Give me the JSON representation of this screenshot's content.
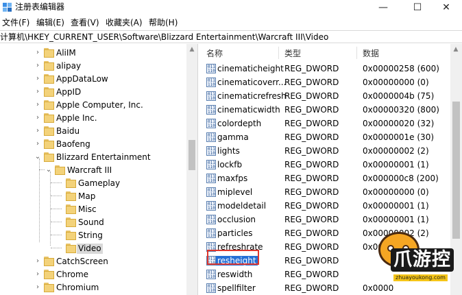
{
  "window": {
    "title": "注册表编辑器",
    "minimize": "—",
    "maximize": "☐",
    "close": "✕"
  },
  "menu": [
    "文件(F)",
    "编辑(E)",
    "查看(V)",
    "收藏夹(A)",
    "帮助(H)"
  ],
  "address": "计算机\\HKEY_CURRENT_USER\\Software\\Blizzard Entertainment\\Warcraft III\\Video",
  "tree": {
    "items": [
      {
        "label": "AliIM",
        "expanded": false,
        "depth": 0
      },
      {
        "label": "alipay",
        "expanded": false,
        "depth": 0
      },
      {
        "label": "AppDataLow",
        "expanded": false,
        "depth": 0
      },
      {
        "label": "AppID",
        "expanded": false,
        "depth": 0
      },
      {
        "label": "Apple Computer, Inc.",
        "expanded": false,
        "depth": 0
      },
      {
        "label": "Apple Inc.",
        "expanded": false,
        "depth": 0
      },
      {
        "label": "Baidu",
        "expanded": false,
        "depth": 0
      },
      {
        "label": "Baofeng",
        "expanded": false,
        "depth": 0
      },
      {
        "label": "Blizzard Entertainment",
        "expanded": true,
        "depth": 0
      },
      {
        "label": "Warcraft III",
        "expanded": true,
        "depth": 1
      },
      {
        "label": "Gameplay",
        "expanded": null,
        "depth": 2
      },
      {
        "label": "Map",
        "expanded": null,
        "depth": 2
      },
      {
        "label": "Misc",
        "expanded": null,
        "depth": 2
      },
      {
        "label": "Sound",
        "expanded": null,
        "depth": 2
      },
      {
        "label": "String",
        "expanded": null,
        "depth": 2
      },
      {
        "label": "Video",
        "expanded": null,
        "depth": 2,
        "selected": true
      },
      {
        "label": "CatchScreen",
        "expanded": false,
        "depth": 0
      },
      {
        "label": "Chrome",
        "expanded": false,
        "depth": 0
      },
      {
        "label": "Chromium",
        "expanded": false,
        "depth": 0
      }
    ]
  },
  "values_pane": {
    "headers": {
      "name": "名称",
      "type": "类型",
      "data": "数据"
    },
    "rows": [
      {
        "name": "cinematicheight",
        "type": "REG_DWORD",
        "data": "0x00000258 (600)"
      },
      {
        "name": "cinematicoverr...",
        "type": "REG_DWORD",
        "data": "0x00000000 (0)"
      },
      {
        "name": "cinematicrefresh",
        "type": "REG_DWORD",
        "data": "0x0000004b (75)"
      },
      {
        "name": "cinematicwidth",
        "type": "REG_DWORD",
        "data": "0x00000320 (800)"
      },
      {
        "name": "colordepth",
        "type": "REG_DWORD",
        "data": "0x00000020 (32)"
      },
      {
        "name": "gamma",
        "type": "REG_DWORD",
        "data": "0x0000001e (30)"
      },
      {
        "name": "lights",
        "type": "REG_DWORD",
        "data": "0x00000002 (2)"
      },
      {
        "name": "lockfb",
        "type": "REG_DWORD",
        "data": "0x00000001 (1)"
      },
      {
        "name": "maxfps",
        "type": "REG_DWORD",
        "data": "0x000000c8 (200)"
      },
      {
        "name": "miplevel",
        "type": "REG_DWORD",
        "data": "0x00000000 (0)"
      },
      {
        "name": "modeldetail",
        "type": "REG_DWORD",
        "data": "0x00000001 (1)"
      },
      {
        "name": "occlusion",
        "type": "REG_DWORD",
        "data": "0x00000001 (1)"
      },
      {
        "name": "particles",
        "type": "REG_DWORD",
        "data": "0x00000002 (2)"
      },
      {
        "name": "refreshrate",
        "type": "REG_DWORD",
        "data": "0x00"
      },
      {
        "name": "resheight",
        "type": "REG_DWORD",
        "data": "",
        "selected": true
      },
      {
        "name": "reswidth",
        "type": "REG_DWORD",
        "data": ""
      },
      {
        "name": "spellfilter",
        "type": "REG_DWORD",
        "data": "0x0000"
      }
    ]
  },
  "watermark": {
    "brand": "爪游控",
    "url": "zhuayoukong.com"
  }
}
